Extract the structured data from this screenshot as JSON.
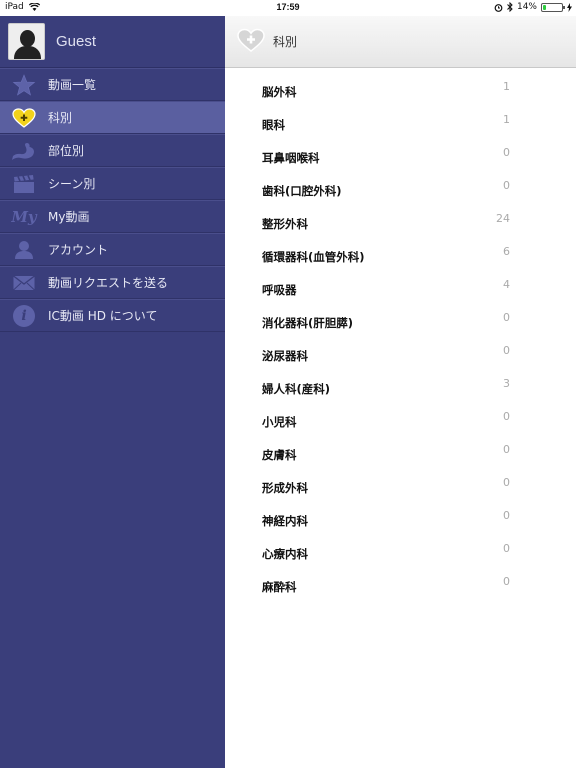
{
  "status_bar": {
    "device": "iPad",
    "time": "17:59",
    "battery": "14%",
    "battery_level": 0.14
  },
  "sidebar": {
    "user_name": "Guest",
    "items": [
      {
        "label": "動画一覧",
        "icon": "star-icon"
      },
      {
        "label": "科別",
        "icon": "heart-plus-icon",
        "selected": true
      },
      {
        "label": "部位別",
        "icon": "stomach-icon"
      },
      {
        "label": "シーン別",
        "icon": "clapperboard-icon"
      },
      {
        "label": "My動画",
        "icon": "my-icon",
        "icon_text": "My"
      },
      {
        "label": "アカウント",
        "icon": "person-icon"
      },
      {
        "label": "動画リクエストを送る",
        "icon": "envelope-icon"
      },
      {
        "label": "IC動画 HD について",
        "icon": "info-icon",
        "icon_text": "i"
      }
    ]
  },
  "header": {
    "title": "科別"
  },
  "departments": [
    {
      "name": "脳外科",
      "count": "1"
    },
    {
      "name": "眼科",
      "count": "1"
    },
    {
      "name": "耳鼻咽喉科",
      "count": "0"
    },
    {
      "name": "歯科(口腔外科)",
      "count": "0"
    },
    {
      "name": "整形外科",
      "count": "24"
    },
    {
      "name": "循環器科(血管外科)",
      "count": "6"
    },
    {
      "name": "呼吸器",
      "count": "4"
    },
    {
      "name": "消化器科(肝胆膵)",
      "count": "0"
    },
    {
      "name": "泌尿器科",
      "count": "0"
    },
    {
      "name": "婦人科(産科)",
      "count": "3"
    },
    {
      "name": "小児科",
      "count": "0"
    },
    {
      "name": "皮膚科",
      "count": "0"
    },
    {
      "name": "形成外科",
      "count": "0"
    },
    {
      "name": "神経内科",
      "count": "0"
    },
    {
      "name": "心療内科",
      "count": "0"
    },
    {
      "name": "麻酔科",
      "count": "0"
    }
  ],
  "colors": {
    "sidebar_bg": "#3a3e7b",
    "selected_bg": "#5a5fa0",
    "accent_yellow": "#f2d21b"
  }
}
